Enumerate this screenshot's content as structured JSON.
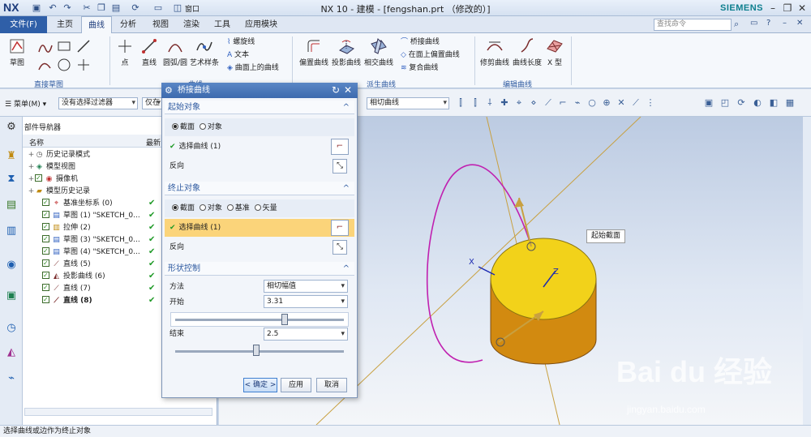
{
  "app": {
    "logo": "NX",
    "window_title": "NX 10 - 建模 - [fengshan.prt （修改的）]",
    "brand": "SIEMENS",
    "window_menu": "窗口"
  },
  "menu": {
    "file": "文件(F)",
    "tabs": [
      "主页",
      "曲线",
      "分析",
      "视图",
      "渲染",
      "工具",
      "应用模块"
    ],
    "active_tab": "曲线",
    "search_placeholder": "查找命令"
  },
  "ribbon": {
    "groups": [
      "直接草图",
      "曲线",
      "派生曲线",
      "编辑曲线"
    ],
    "sketch_label": "草图",
    "curve_buttons": [
      "点",
      "直线",
      "圆弧/圆",
      "艺术样条"
    ],
    "curve_small": [
      "螺旋线",
      "文本",
      "曲面上的曲线"
    ],
    "derived_buttons": [
      "偏置曲线",
      "投影曲线",
      "相交曲线"
    ],
    "derived_small": [
      "桥接曲线",
      "在面上偏置曲线",
      "复合曲线"
    ],
    "edit_buttons": [
      "修剪曲线",
      "曲线长度",
      "X 型"
    ]
  },
  "toolbar": {
    "menu_label": "菜单(M)",
    "filter_select": "没有选择过滤器",
    "scope_select": "仅在",
    "snap_select": "相切曲线"
  },
  "navigator": {
    "title": "部件导航器",
    "col_name": "名称",
    "col_latest": "最新",
    "items": [
      {
        "label": "历史记录模式",
        "indent": 1,
        "check": false,
        "bold": false,
        "latest": false
      },
      {
        "label": "模型视图",
        "indent": 1,
        "check": false,
        "bold": false,
        "latest": false
      },
      {
        "label": "摄像机",
        "indent": 1,
        "check": true,
        "bold": false,
        "latest": false
      },
      {
        "label": "模型历史记录",
        "indent": 1,
        "check": false,
        "bold": false,
        "latest": false
      },
      {
        "label": "基准坐标系 (0)",
        "indent": 2,
        "check": true,
        "bold": false,
        "latest": true
      },
      {
        "label": "草图 (1) \"SKETCH_0...",
        "indent": 2,
        "check": true,
        "bold": false,
        "latest": true
      },
      {
        "label": "拉伸 (2)",
        "indent": 2,
        "check": true,
        "bold": false,
        "latest": true
      },
      {
        "label": "草图 (3) \"SKETCH_0...",
        "indent": 2,
        "check": true,
        "bold": false,
        "latest": true
      },
      {
        "label": "草图 (4) \"SKETCH_0...",
        "indent": 2,
        "check": true,
        "bold": false,
        "latest": true
      },
      {
        "label": "直线 (5)",
        "indent": 2,
        "check": true,
        "bold": false,
        "latest": true
      },
      {
        "label": "投影曲线 (6)",
        "indent": 2,
        "check": true,
        "bold": false,
        "latest": true
      },
      {
        "label": "直线 (7)",
        "indent": 2,
        "check": true,
        "bold": false,
        "latest": true
      },
      {
        "label": "直线 (8)",
        "indent": 2,
        "check": true,
        "bold": true,
        "latest": true
      }
    ]
  },
  "dialog": {
    "title": "桥接曲线",
    "start_section": "起始对象",
    "start_opt_section": "截面",
    "start_opt_object": "对象",
    "select_curve": "选择曲线 (1)",
    "reverse": "反向",
    "end_section": "终止对象",
    "end_opt_section": "截面",
    "end_opt_object": "对象",
    "end_opt_datum": "基准",
    "end_opt_vector": "矢量",
    "shape_section": "形状控制",
    "method_label": "方法",
    "method_value": "相切幅值",
    "start_label": "开始",
    "start_value": "3.31",
    "start_fraction": 0.65,
    "end_label": "结束",
    "end_value": "2.5",
    "end_fraction": 0.48,
    "ok": "< 确定 >",
    "apply": "应用",
    "cancel": "取消"
  },
  "graphics": {
    "tooltip": "起始截面",
    "watermark": "Bai du 经验",
    "watermark_url": "jingyan.baidu.com",
    "axis_x": "X",
    "axis_z": "Z",
    "colors": {
      "cylinder": "#f2d21a",
      "cylinder_side": "#d28a10",
      "curve": "#c020b0",
      "handle": "#c8a040"
    }
  },
  "status": {
    "message": "选择曲线或边作为终止对象"
  }
}
